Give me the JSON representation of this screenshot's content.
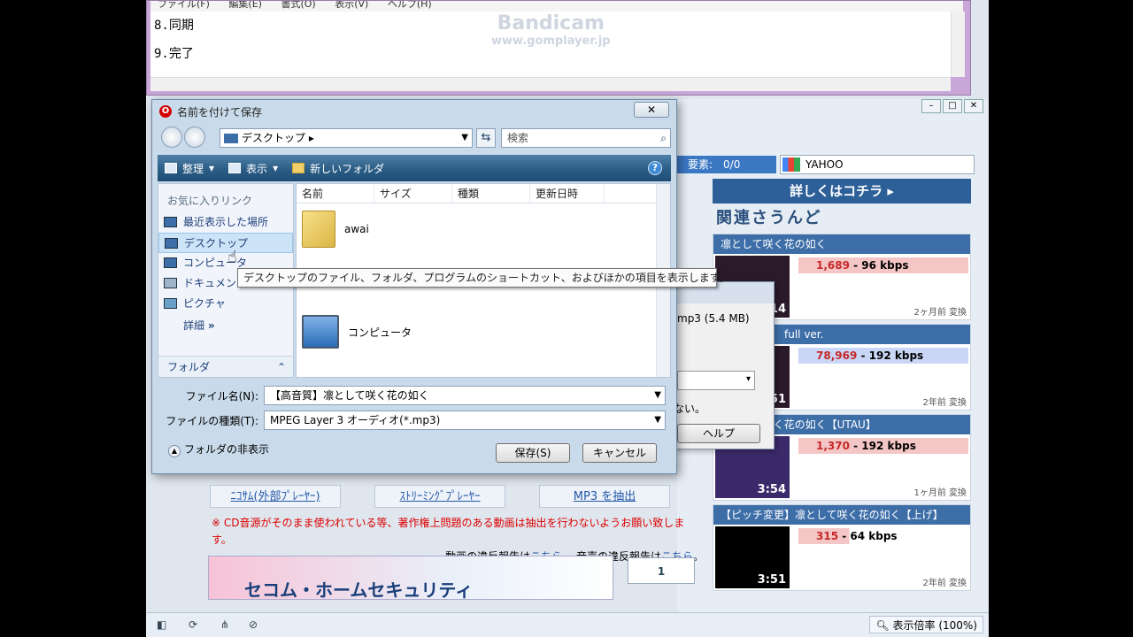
{
  "watermark": {
    "line1": "Bandicam",
    "line2": "www.gomplayer.jp"
  },
  "notepad": {
    "menu": [
      "ファイル(F)",
      "編集(E)",
      "書式(O)",
      "表示(V)",
      "ヘルプ(H)"
    ],
    "lines": [
      "8.同期",
      "9.完了"
    ]
  },
  "browser": {
    "elements": "要素:　0/0",
    "search_value": "YAHOO",
    "banner": "詳しくはコチラ ▸",
    "related_title": "関連さうんど",
    "cards": [
      {
        "title": "凛として咲く花の如く",
        "stat_num": "1,689",
        "stat_rate": " - 96 kbps",
        "duration": "14",
        "ago": "2ヶ月前 変換"
      },
      {
        "title": "く花の如く　full ver.",
        "stat_num": "78,969",
        "stat_rate": " - 192 kbps",
        "duration": "51",
        "ago": "2年前 変換"
      },
      {
        "title": "凛として咲く花の如く【UTAU】",
        "stat_num": "1,370",
        "stat_rate": " - 192 kbps",
        "duration": "3:54",
        "ago": "1ヶ月前 変換"
      },
      {
        "title": "【ピッチ変更】凛として咲く花の如く【上げ】",
        "stat_num": "315",
        "stat_rate": " - 64 kbps",
        "duration": "3:51",
        "ago": "2年前 変換"
      }
    ],
    "links": [
      "ﾆｺｻﾑ(外部ﾌﾟﾚｰﾔｰ)",
      "ｽﾄﾘｰﾐﾝｸﾞﾌﾟﾚｰﾔｰ",
      "MP3 を抽出"
    ],
    "notice_red": "※ CD音源がそのまま使われている等、著作権上問題のある動画は抽出を行わないようお願い致します。",
    "notice_prefix": "動画の違反報告は",
    "notice_link1": "こちら",
    "notice_mid": "。 音声の違反報告は",
    "notice_link2": "こちら",
    "notice_end": "。",
    "ad_text": "セコム・ホームセキュリティ",
    "page_num": "1",
    "zoom": "表示倍率 (100%)"
  },
  "download_dialog": {
    "size": "mp3 (5.4 MB)",
    "message": "ない。",
    "help": "ヘルプ"
  },
  "save_dialog": {
    "title": "名前を付けて保存",
    "close": "✕",
    "address": "デスクトップ",
    "search_placeholder": "検索",
    "cmd": {
      "organize": "整理",
      "view": "表示",
      "new_folder": "新しいフォルダ"
    },
    "favorites_header": "お気に入りリンク",
    "favorites": [
      "最近表示した場所",
      "デスクトップ",
      "コンピュータ",
      "ドキュメント",
      "ピクチャ"
    ],
    "more": "詳細",
    "folders": "フォルダ",
    "columns": [
      "名前",
      "サイズ",
      "種類",
      "更新日時"
    ],
    "files": [
      "awai",
      "コンピュータ"
    ],
    "tooltip": "デスクトップのファイル、フォルダ、プログラムのショートカット、およびほかの項目を表示します。",
    "filename_label": "ファイル名(N):",
    "filename_value": "【高音質】凛として咲く花の如く",
    "filetype_label": "ファイルの種類(T):",
    "filetype_value": "MPEG Layer 3 オーディオ(*.mp3)",
    "hide_folders": "フォルダの非表示",
    "save_button": "保存(S)",
    "cancel_button": "キャンセル"
  }
}
